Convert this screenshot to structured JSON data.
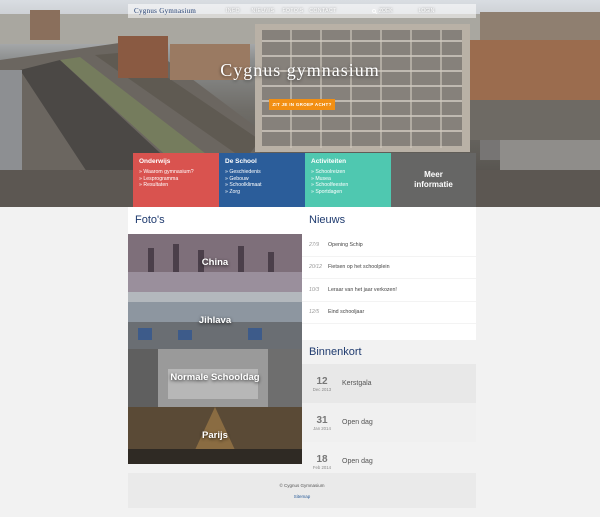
{
  "topbar": {
    "logo": "Cygnus Gymnasium",
    "nav": [
      "INFO",
      "NIEUWS",
      "FOTO'S",
      "CONTACT"
    ],
    "search_label": "ZOEK",
    "login_label": "LOGIN"
  },
  "hero": {
    "title": "Cygnus gymnasium",
    "cta_label": "ZIT JE IN GROEP ACHT?"
  },
  "tiles": [
    {
      "title": "Onderwijs",
      "items": [
        "Waarom gymnasium?",
        "Lesprogramma",
        "Resultaten"
      ],
      "color": "#d9534f"
    },
    {
      "title": "De School",
      "items": [
        "Geschiedenis",
        "Gebouw",
        "Schoolklimaat",
        "Zorg"
      ],
      "color": "#2b5d9a"
    },
    {
      "title": "Activiteiten",
      "items": [
        "Schoolreizen",
        "Musea",
        "Schoolfeesten",
        "Sportdagen"
      ],
      "color": "#4fc8b0"
    },
    {
      "title_line1": "Meer",
      "title_line2": "informatie",
      "color": "#666665"
    }
  ],
  "photos": {
    "heading": "Foto's",
    "items": [
      "China",
      "Jihlava",
      "Normale Schooldag",
      "Parijs"
    ]
  },
  "news": {
    "heading": "Nieuws",
    "items": [
      {
        "date": "27/9",
        "text": "Opening Schip"
      },
      {
        "date": "20/12",
        "text": "Fietsen op het schoolplein"
      },
      {
        "date": "10/3",
        "text": "Leraar van het jaar verkozen!"
      },
      {
        "date": "12/5",
        "text": "Eind schooljaar"
      }
    ]
  },
  "agenda": {
    "heading": "Binnenkort",
    "items": [
      {
        "day": "12",
        "month": "Dec 2013",
        "title": "Kerstgala"
      },
      {
        "day": "31",
        "month": "Jan 2014",
        "title": "Open dag"
      },
      {
        "day": "18",
        "month": "Feb 2014",
        "title": "Open dag"
      }
    ]
  },
  "footer": {
    "copyright": "© Cygnus Gymnasium",
    "sitemap": "Sitemap"
  }
}
